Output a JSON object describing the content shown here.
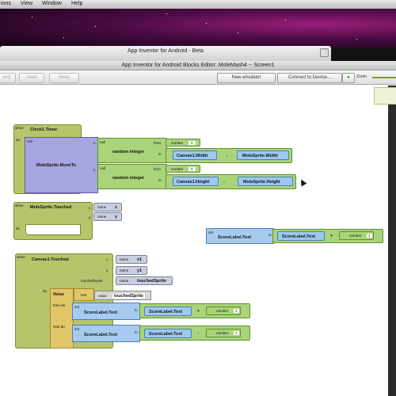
{
  "menubar": {
    "items": [
      "ions",
      "View",
      "Window",
      "Help"
    ]
  },
  "bg_window": {
    "title": "App Inventor for Android - Beta"
  },
  "editor": {
    "title": "App Inventor for Android Blocks Editor: MoleMash4 -- Screen1",
    "toolbar": {
      "save": "ved",
      "undo": "Undo",
      "redo": "Redo",
      "new_emulator": "New emulator",
      "connect": "Connect to Device...",
      "zoom": "Zoom"
    }
  },
  "blocks": {
    "timer": {
      "event_tag": "when",
      "event": "Clock1.Timer",
      "do": "do",
      "call": "call",
      "procedure": "MoleSprite.MoveTo",
      "x": "x",
      "y": "y",
      "from": "from",
      "to": "to",
      "random": "random integer",
      "num1": "number",
      "num1_val": "0",
      "num2": "number",
      "num2_val": "0",
      "width_left": "Canvas1.Width",
      "minus": "-",
      "width_right": "MoleSprite.Width",
      "height_left": "Canvas1.Height",
      "height_right": "MoleSprite.Height"
    },
    "touched": {
      "event_tag": "when",
      "event": "MoleSprite.Touched",
      "x": "x",
      "y": "y",
      "name": "name",
      "arg_x": "x",
      "arg_y": "y",
      "do": "do"
    },
    "score": {
      "set": "set",
      "target": "ScoreLabel.Text",
      "to": "to",
      "getter": "ScoreLabel.Text",
      "plus": "+",
      "number": "number",
      "val": "1"
    },
    "canvas": {
      "event_tag": "when",
      "event": "Canvas1.Touched",
      "x": "x",
      "y": "y",
      "touched": "touchedSprite",
      "name": "name",
      "arg_x": "x1",
      "arg_y": "y1",
      "arg_t": "touchedSprite",
      "do": "do",
      "ifelse": "ifelse",
      "test": "test",
      "value": "value",
      "value_name": "touchedSprite",
      "then_do": "then-do",
      "else_do": "else-do",
      "set": "set",
      "to": "to",
      "target": "ScoreLabel.Text",
      "getter": "ScoreLabel.Text",
      "plus": "+",
      "minus": "-",
      "number": "number",
      "val": "1"
    }
  }
}
